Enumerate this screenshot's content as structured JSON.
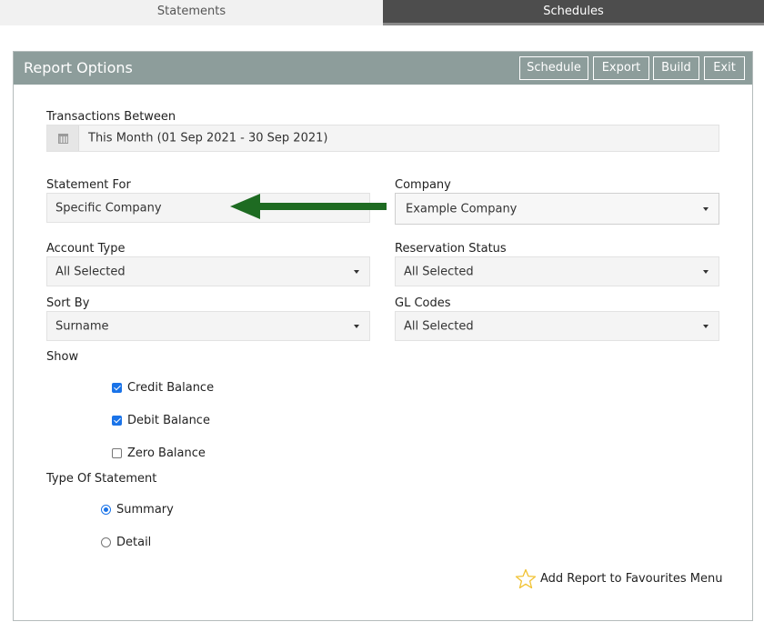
{
  "tabs": [
    {
      "label": "Statements",
      "active": false
    },
    {
      "label": "Schedules",
      "active": true
    }
  ],
  "panel": {
    "title": "Report Options",
    "buttons": {
      "schedule": "Schedule",
      "export": "Export",
      "build": "Build",
      "exit": "Exit"
    }
  },
  "form": {
    "transactions_between": {
      "label": "Transactions Between",
      "value": "This Month (01 Sep 2021 - 30 Sep 2021)",
      "icon": "calendar-icon"
    },
    "statement_for": {
      "label": "Statement For",
      "value": "Specific Company"
    },
    "company": {
      "label": "Company",
      "value": "Example Company"
    },
    "account_type": {
      "label": "Account Type",
      "value": "All Selected"
    },
    "reservation_status": {
      "label": "Reservation Status",
      "value": "All Selected"
    },
    "sort_by": {
      "label": "Sort By",
      "value": "Surname"
    },
    "gl_codes": {
      "label": "GL Codes",
      "value": "All Selected"
    },
    "show": {
      "label": "Show",
      "options": [
        {
          "label": "Credit Balance",
          "checked": true
        },
        {
          "label": "Debit Balance",
          "checked": true
        },
        {
          "label": "Zero Balance",
          "checked": false
        }
      ]
    },
    "type_of_statement": {
      "label": "Type Of Statement",
      "options": [
        {
          "label": "Summary",
          "selected": true
        },
        {
          "label": "Detail",
          "selected": false
        }
      ]
    }
  },
  "favourites": {
    "label": "Add Report to Favourites Menu",
    "icon": "star-icon"
  },
  "annotation": {
    "icon": "arrow-left-icon",
    "color": "#1e6b22"
  },
  "colors": {
    "header_bg": "#8d9d9b",
    "active_tab_bg": "#4d4d4d",
    "accent": "#1a73e8"
  }
}
